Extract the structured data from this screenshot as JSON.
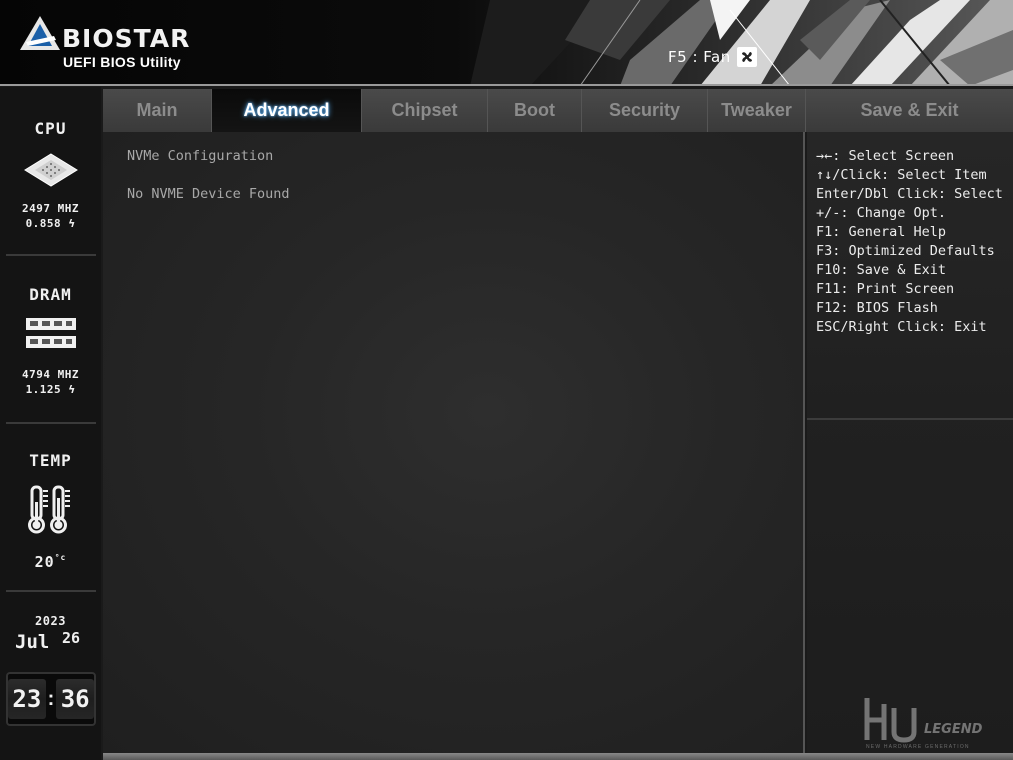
{
  "header": {
    "brand": "BIOSTAR",
    "subtitle": "UEFI BIOS Utility",
    "fan_shortcut": "F5 : Fan",
    "fan_icon": "fan-icon"
  },
  "sidebar": {
    "cpu": {
      "title": "CPU",
      "freq": "2497 MHZ",
      "volt": "0.858",
      "icon": "cpu-chip-icon"
    },
    "dram": {
      "title": "DRAM",
      "freq": "4794 MHZ",
      "volt": "1.125",
      "icon": "dram-module-icon"
    },
    "temp": {
      "title": "TEMP",
      "value": "20",
      "unit": "°c",
      "icon": "thermometer-icon"
    },
    "date": {
      "year": "2023",
      "month": "Jul",
      "day": "26"
    },
    "time": {
      "hours": "23",
      "minutes": "36"
    }
  },
  "tabs": [
    {
      "label": "Main",
      "active": false
    },
    {
      "label": "Advanced",
      "active": true
    },
    {
      "label": "Chipset",
      "active": false
    },
    {
      "label": "Boot",
      "active": false
    },
    {
      "label": "Security",
      "active": false
    },
    {
      "label": "Tweaker",
      "active": false
    },
    {
      "label": "Save & Exit",
      "active": false
    }
  ],
  "main": {
    "heading": "NVMe Configuration",
    "message": "No NVME Device Found"
  },
  "help": [
    "→←: Select Screen",
    "↑↓/Click: Select Item",
    "Enter/Dbl Click: Select",
    "+/-: Change Opt.",
    "F1: General Help",
    "F3: Optimized Defaults",
    "F10: Save & Exit",
    "F11: Print Screen",
    "F12: BIOS Flash",
    "ESC/Right Click: Exit"
  ],
  "watermark": {
    "brand": "LEGEND",
    "tagline": "NEW HARDWARE GENERATION"
  },
  "colors": {
    "accent_glow": "#5ab4ff",
    "active_tab_bg": "#0a0a0a",
    "tab_bg": "#444444"
  }
}
